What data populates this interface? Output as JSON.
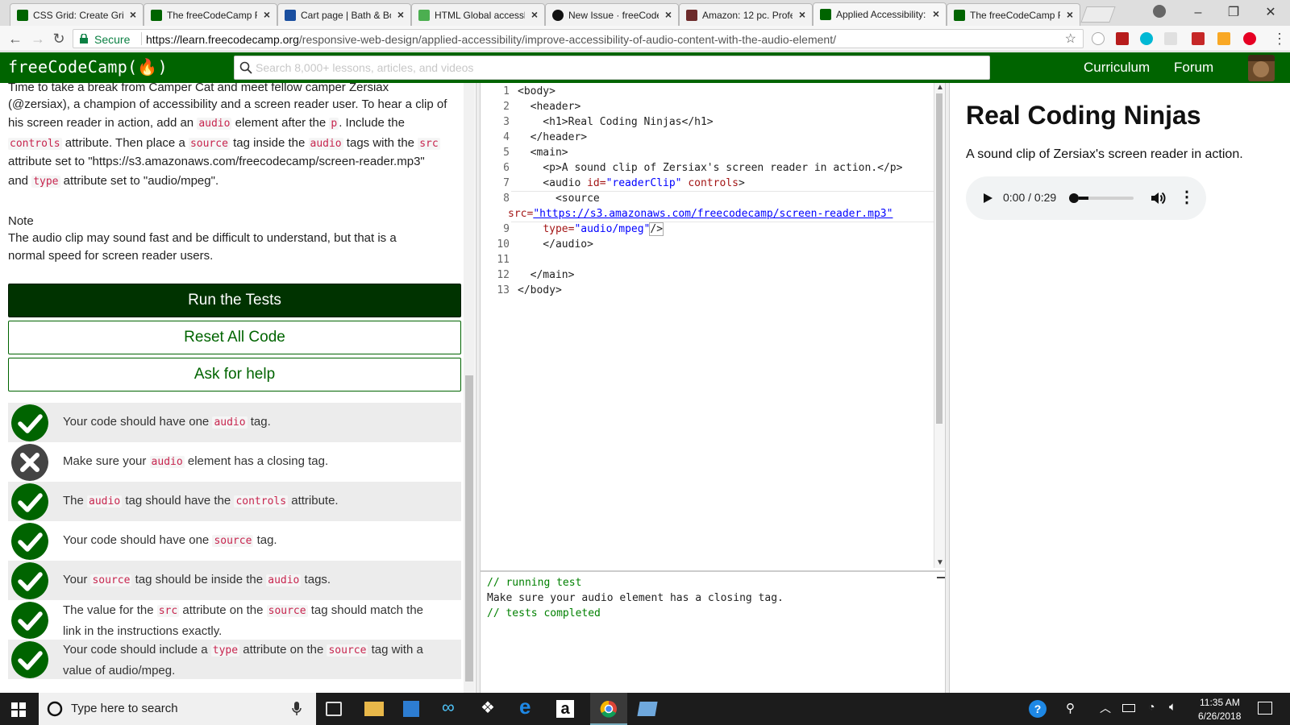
{
  "browser": {
    "tabs": [
      {
        "label": "CSS Grid: Create Grid",
        "favicon_color": "#006400"
      },
      {
        "label": "The freeCodeCamp For",
        "favicon_color": "#006400"
      },
      {
        "label": "Cart page | Bath & Bo",
        "favicon_color": "#1a4fa0"
      },
      {
        "label": "HTML Global accessk",
        "favicon_color": "#4caf50"
      },
      {
        "label": "New Issue · freeCode",
        "favicon_color": "#111111"
      },
      {
        "label": "Amazon: 12 pc. Profe",
        "favicon_color": "#6d2b2b"
      },
      {
        "label": "Applied Accessibility:",
        "favicon_color": "#006400"
      },
      {
        "label": "The freeCodeCamp For",
        "favicon_color": "#006400"
      }
    ],
    "secure_label": "Secure",
    "url_host": "https://learn.freecodecamp.org",
    "url_path": "/responsive-web-design/applied-accessibility/improve-accessibility-of-audio-content-with-the-audio-element/"
  },
  "fcc": {
    "logo": "freeCodeCamp(🔥)",
    "search_placeholder": "Search 8,000+ lessons, articles, and videos",
    "nav": {
      "curriculum": "Curriculum",
      "forum": "Forum"
    }
  },
  "instructions": {
    "line1": "Time to take a break from Camper Cat and meet fellow camper Zersiax",
    "line2": "(@zersiax), a champion of accessibility and a screen reader user. To hear a clip of",
    "seg_a1": "his screen reader in action, add an ",
    "code_audio": "audio",
    "seg_a2": " element after the ",
    "code_p": "p",
    "seg_a3": ". Include the",
    "code_controls": "controls",
    "seg_b1": " attribute. Then place a ",
    "code_source": "source",
    "seg_b2": " tag inside the ",
    "seg_b3": " tags with the ",
    "code_src": "src",
    "line5": "attribute set to \"https://s3.amazonaws.com/freecodecamp/screen-reader.mp3\"",
    "seg_c1": "and ",
    "code_type": "type",
    "seg_c2": " attribute set to \"audio/mpeg\".",
    "note_title": "Note",
    "note_line1": "The audio clip may sound fast and be difficult to understand, but that is a",
    "note_line2": "normal speed for screen reader users."
  },
  "buttons": {
    "run": "Run the Tests",
    "reset": "Reset All Code",
    "help": "Ask for help"
  },
  "tests": [
    {
      "passed": true,
      "parts": [
        "Your code should have one ",
        "audio",
        " tag."
      ]
    },
    {
      "passed": false,
      "parts": [
        "Make sure your ",
        "audio",
        " element has a closing tag."
      ]
    },
    {
      "passed": true,
      "parts": [
        "The ",
        "audio",
        " tag should have the ",
        "controls",
        " attribute."
      ]
    },
    {
      "passed": true,
      "parts": [
        "Your code should have one ",
        "source",
        " tag."
      ]
    },
    {
      "passed": true,
      "parts": [
        "Your ",
        "source",
        " tag should be inside the ",
        "audio",
        " tags."
      ]
    },
    {
      "passed": true,
      "parts": [
        "The value for the ",
        "src",
        " attribute on the ",
        "source",
        " tag should match the",
        "link in the instructions exactly."
      ]
    },
    {
      "passed": true,
      "parts": [
        "Your code should include a ",
        "type",
        " attribute on the ",
        "source",
        " tag with a",
        "value of audio/mpeg."
      ]
    }
  ],
  "editor": {
    "line_numbers": [
      "1",
      "2",
      "3",
      "4",
      "5",
      "6",
      "7",
      "8",
      "9",
      "10",
      "11",
      "12",
      "13"
    ],
    "l1": "<body>",
    "l2": "  <header>",
    "l3": "    <h1>Real Coding Ninjas</h1>",
    "l4": "  </header>",
    "l5": "  <main>",
    "l6": "    <p>A sound clip of Zersiax's screen reader in action.</p>",
    "l7a": "    <audio ",
    "l7b": "id=",
    "l7c": "\"readerClip\"",
    "l7d": " controls",
    "l7e": ">",
    "l8": "      <source",
    "l8b_attr": "src=",
    "l8b_val": "\"https://s3.amazonaws.com/freecodecamp/screen-reader.mp3\"",
    "l9a": "    ",
    "l9b": "type=",
    "l9c": "\"audio/mpeg\"",
    "l9d": "/>",
    "l10": "    </audio>",
    "l11": "",
    "l12": "  </main>",
    "l13": "</body>"
  },
  "console": {
    "line1": "// running test",
    "line2": "Make sure your audio element has a closing tag.",
    "line3": "// tests completed"
  },
  "preview": {
    "heading": "Real Coding Ninjas",
    "paragraph": "A sound clip of Zersiax's screen reader in action.",
    "audio_time": "0:00 / 0:29",
    "audio_progress": 0.0
  },
  "taskbar": {
    "search_placeholder": "Type here to search",
    "time": "11:35 AM",
    "date": "6/26/2018"
  }
}
